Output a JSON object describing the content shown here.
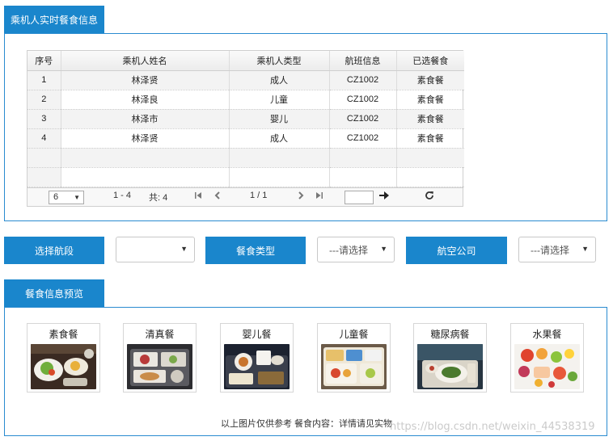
{
  "passenger_section": {
    "title": "乘机人实时餐食信息",
    "columns": [
      "序号",
      "乘机人姓名",
      "乘机人类型",
      "航班信息",
      "已选餐食"
    ],
    "rows": [
      {
        "no": "1",
        "name": "林泽贤",
        "type": "成人",
        "flight": "CZ1002",
        "meal": "素食餐"
      },
      {
        "no": "2",
        "name": "林泽良",
        "type": "儿童",
        "flight": "CZ1002",
        "meal": "素食餐"
      },
      {
        "no": "3",
        "name": "林泽市",
        "type": "婴儿",
        "flight": "CZ1002",
        "meal": "素食餐"
      },
      {
        "no": "4",
        "name": "林泽贤",
        "type": "成人",
        "flight": "CZ1002",
        "meal": "素食餐"
      }
    ],
    "pager": {
      "page_size": "6",
      "range": "1 - 4",
      "total": "共: 4",
      "page": "1 / 1",
      "first_icon": "first-page-icon",
      "prev_icon": "prev-page-icon",
      "next_icon": "next-page-icon",
      "last_icon": "last-page-icon",
      "go_icon": "arrow-right-icon",
      "refresh_icon": "refresh-icon"
    }
  },
  "filters": {
    "segment_label": "选择航段",
    "segment_value": "",
    "meal_type_label": "餐食类型",
    "meal_type_value": "---请选择",
    "airline_label": "航空公司",
    "airline_value": "---请选择"
  },
  "preview_section": {
    "title": "餐食信息预览",
    "meals": [
      "素食餐",
      "清真餐",
      "婴儿餐",
      "儿童餐",
      "糖尿病餐",
      "水果餐"
    ],
    "note": "以上图片仅供参考 餐食内容：详情请见实物"
  },
  "watermark": "https://blog.csdn.net/weixin_44538319",
  "colors": {
    "accent": "#1a86cc",
    "border": "#2a8bd0"
  }
}
